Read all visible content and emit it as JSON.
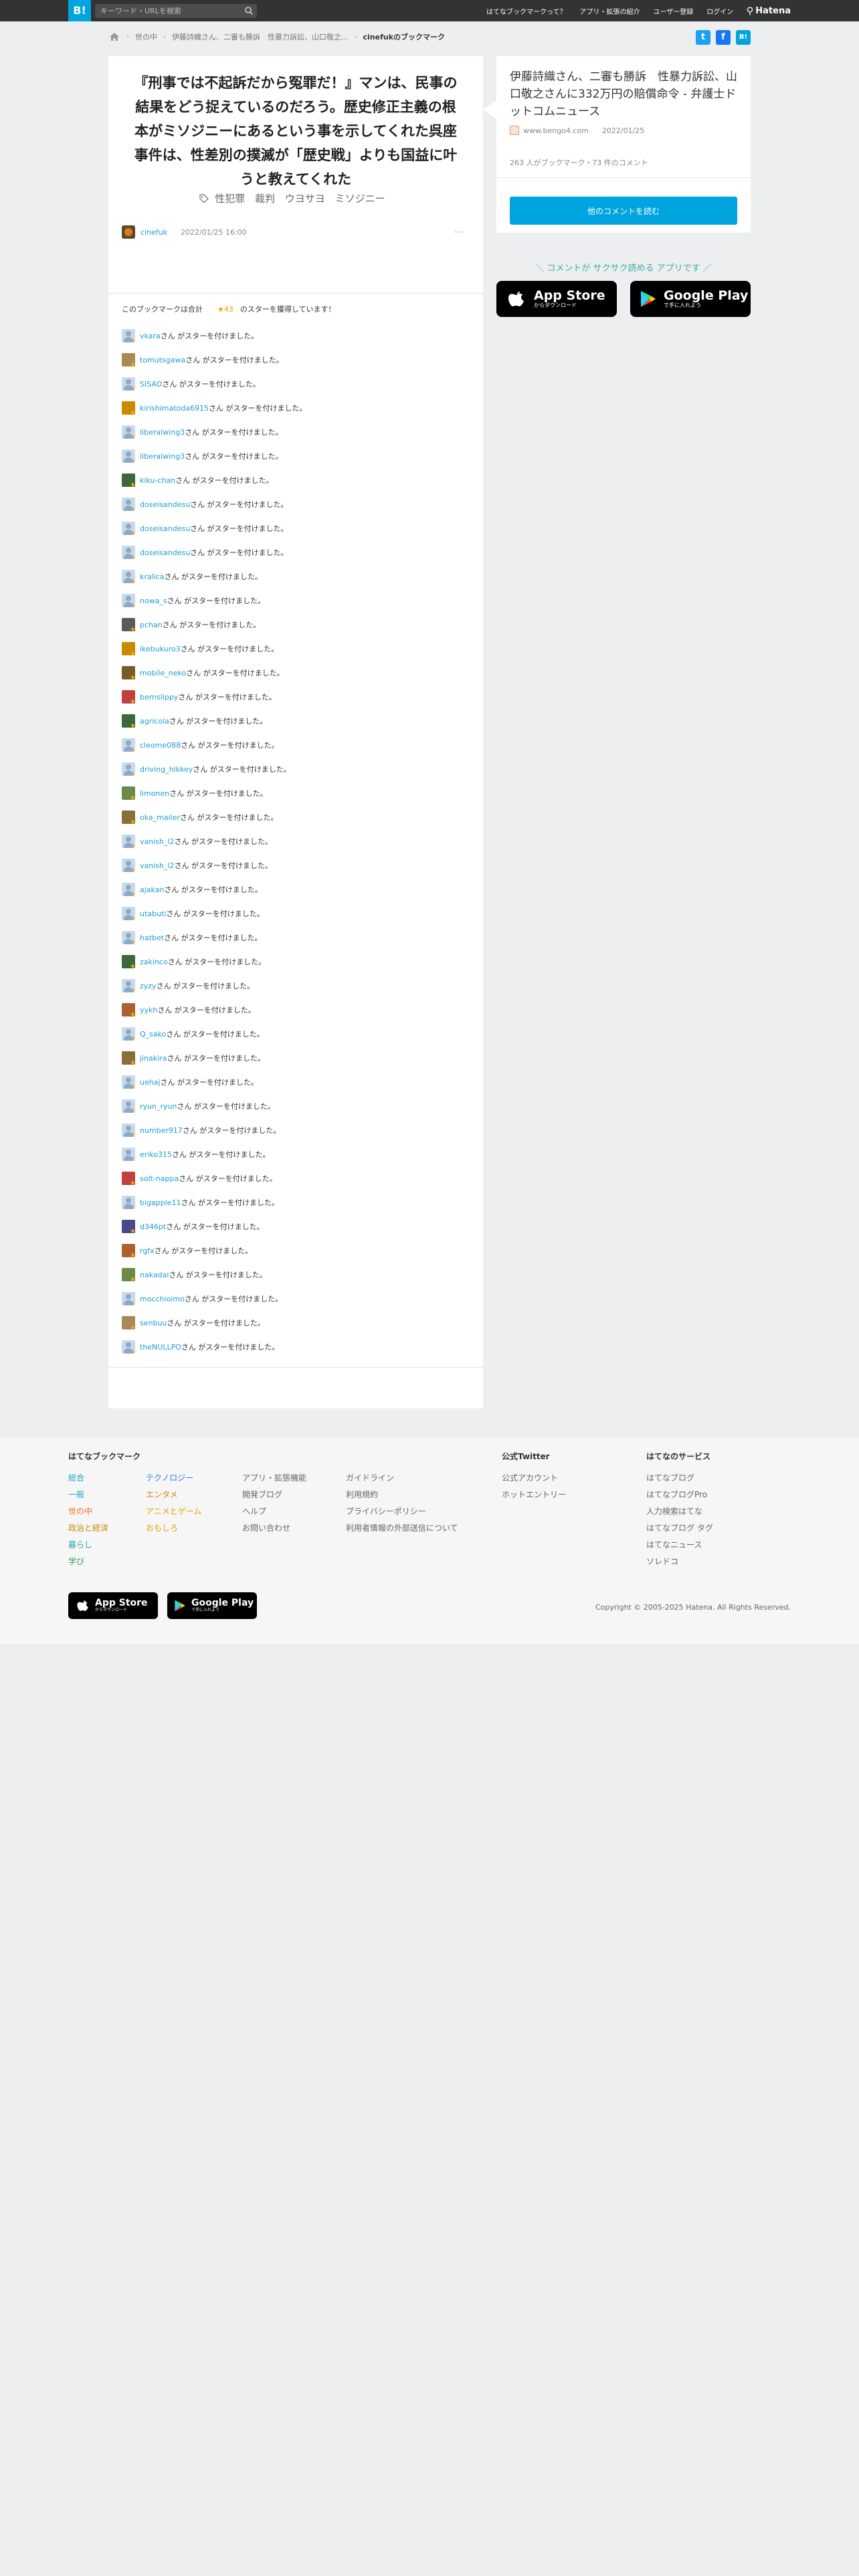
{
  "header": {
    "logo": "B!",
    "search_placeholder": "キーワード・URLを検索",
    "nav": [
      "はてなブックマークって？",
      "アプリ・拡張の紹介",
      "ユーザー登録",
      "ログイン"
    ],
    "brand": "Hatena"
  },
  "breadcrumb": {
    "items": [
      "世の中",
      "伊藤詩織さん、二審も勝訴　性暴力訴訟、山口敬之..."
    ],
    "current": "cinefukのブックマーク"
  },
  "share": {
    "twitter": "t",
    "facebook": "f",
    "hatena": "B!"
  },
  "entry": {
    "title": "『刑事では不起訴だから冤罪だ！』マンは、民事の結果をどう捉えているのだろう。歴史修正主義の根本がミソジニーにあるという事を示してくれた呉座事件は、性差別の撲滅が「歴史戦」よりも国益に叶うと教えてくれた",
    "tags": [
      "性犯罪",
      "裁判",
      "ウヨサヨ",
      "ミソジニー"
    ],
    "user": "cinefuk",
    "date": "2022/01/25 16:00",
    "more": "···"
  },
  "stars": {
    "summary_prefix": "このブックマークは合計",
    "count": "★43",
    "summary_suffix": "のスターを獲得しています！",
    "suffix": "さん がスターを付けました。",
    "users": [
      "vkara",
      "tomutsgawa",
      "SISAO",
      "kirishimatoda6915",
      "liberalwing3",
      "liberalwing3",
      "kiku-chan",
      "doseisandesu",
      "doseisandesu",
      "doseisandesu",
      "kralica",
      "nowa_s",
      "pchan",
      "ikebukuro3",
      "mobile_neko",
      "bernslippy",
      "agricola",
      "cleome088",
      "driving_hikkey",
      "limonen",
      "oka_mailer",
      "vanish_l2",
      "vanish_l2",
      "ajakan",
      "utabuti",
      "hatbet",
      "zakinco",
      "zyzy",
      "yykh",
      "Q_sako",
      "jinakira",
      "uehaj",
      "ryun_ryun",
      "number917",
      "eriko315",
      "solt-nappa",
      "bigapple11",
      "d346pt",
      "rgfx",
      "nakadai",
      "mocchioimo",
      "senbuu",
      "theNULLPO"
    ]
  },
  "side": {
    "title": "伊藤詩織さん、二審も勝訴　性暴力訴訟、山口敬之さんに332万円の賠償命令 - 弁護士ドットコムニュース",
    "source": "www.bengo4.com",
    "date": "2022/01/25",
    "count": "263 人がブックマーク・73 件のコメント",
    "button": "他のコメントを読む"
  },
  "promo": {
    "text": "＼ コメントが サクサク読める アプリです ／",
    "appstore_big": "App Store",
    "appstore_small": "からダウンロード",
    "gplay_big": "Google Play",
    "gplay_small": "で手に入れよう"
  },
  "footer": {
    "title": "はてなブックマーク",
    "cat1": [
      "総合",
      "一般",
      "世の中",
      "政治と経済",
      "暮らし",
      "学び"
    ],
    "cat2": [
      "テクノロジー",
      "エンタメ",
      "アニメとゲーム",
      "おもしろ"
    ],
    "links1": [
      "アプリ・拡張機能",
      "開発ブログ",
      "ヘルプ",
      "お問い合わせ"
    ],
    "links2": [
      "ガイドライン",
      "利用規約",
      "プライバシーポリシー",
      "利用者情報の外部送信について"
    ],
    "twitter_title": "公式Twitter",
    "twitter_links": [
      "公式アカウント",
      "ホットエントリー"
    ],
    "services_title": "はてなのサービス",
    "services": [
      "はてなブログ",
      "はてなブログPro",
      "人力検索はてな",
      "はてなブログ タグ",
      "はてなニュース",
      "ソレドコ"
    ],
    "copyright": "Copyright © 2005-2025 Hatena. All Rights Reserved."
  },
  "colors": {
    "accent": "#00a4de",
    "link": "#1a9fcf",
    "star": "#e8a000"
  }
}
